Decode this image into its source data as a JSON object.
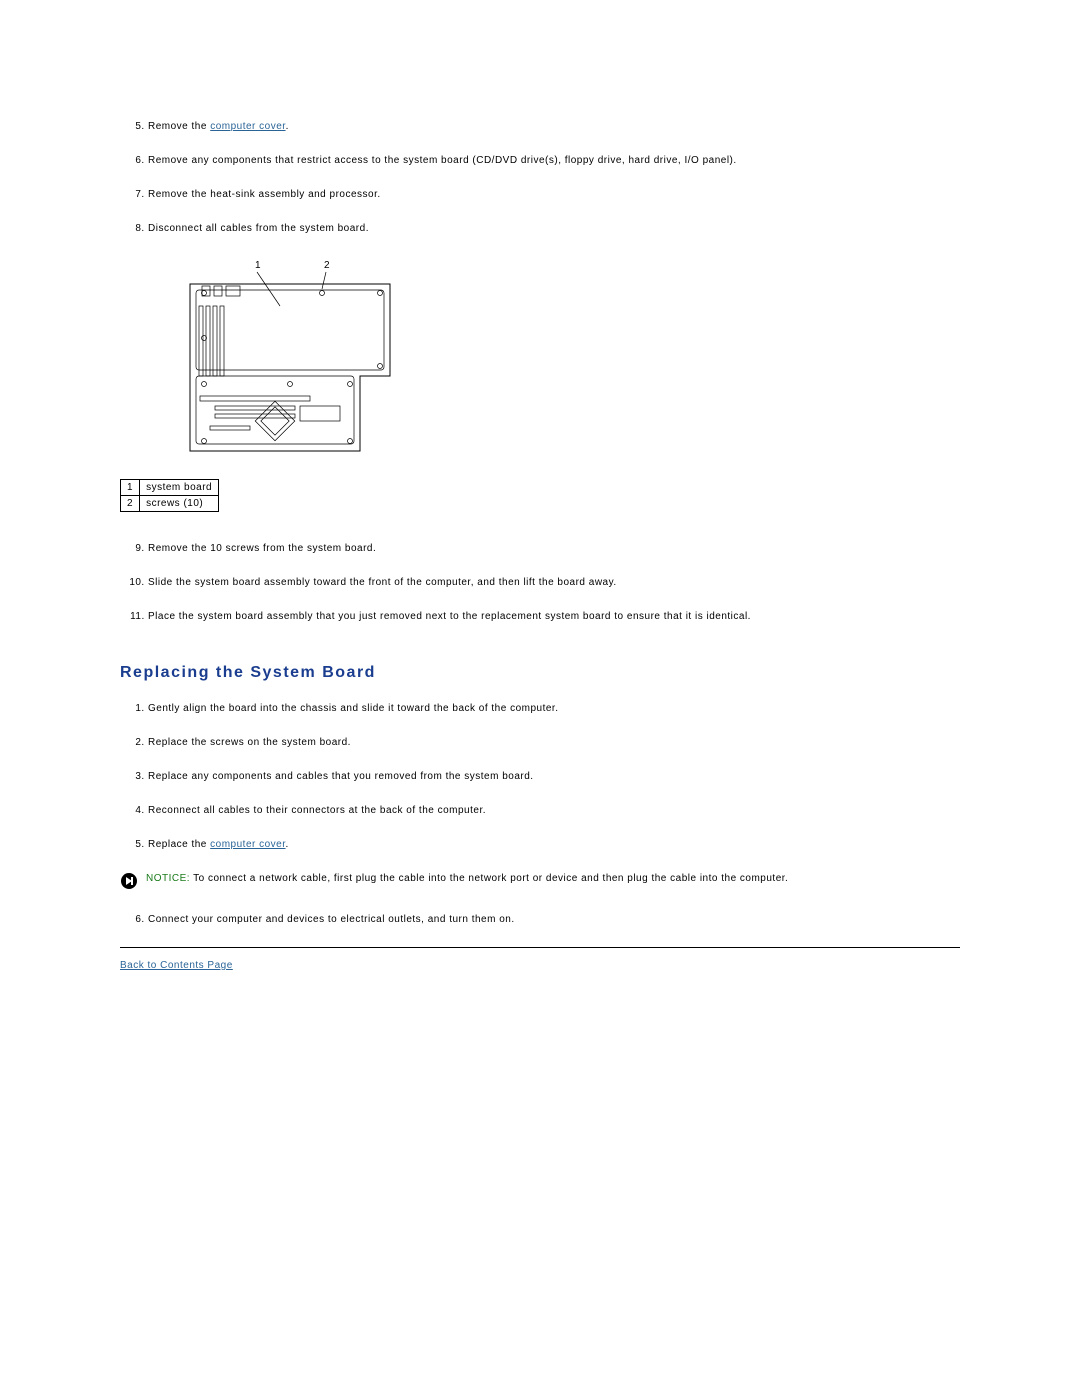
{
  "list1": {
    "start": 5,
    "items": [
      {
        "prefix": "Remove the ",
        "link": "computer cover",
        "suffix": "."
      },
      {
        "text": "Remove any components that restrict access to the system board (CD/DVD drive(s), floppy drive, hard drive, I/O panel)."
      },
      {
        "text": "Remove the heat-sink assembly and processor."
      },
      {
        "text": "Disconnect all cables from the system board."
      }
    ]
  },
  "diagram": {
    "labels": {
      "l1": "1",
      "l2": "2"
    },
    "legend": [
      {
        "num": "1",
        "label": "system board"
      },
      {
        "num": "2",
        "label": "screws (10)"
      }
    ]
  },
  "list2": {
    "start": 9,
    "items": [
      {
        "text": "Remove the 10 screws from the system board."
      },
      {
        "text": "Slide the system board assembly toward the front of the computer, and then lift the board away."
      },
      {
        "text": "Place the system board assembly that you just removed next to the replacement system board to ensure that it is identical."
      }
    ]
  },
  "section_heading": "Replacing the System Board",
  "list3": {
    "start": 1,
    "items": [
      {
        "text": "Gently align the board into the chassis and slide it toward the back of the computer."
      },
      {
        "text": "Replace the screws on the system board."
      },
      {
        "text": "Replace any components and cables that you removed from the system board."
      },
      {
        "text": "Reconnect all cables to their connectors at the back of the computer."
      },
      {
        "prefix": "Replace the ",
        "link": "computer cover",
        "suffix": "."
      }
    ]
  },
  "notice": {
    "label": "NOTICE:",
    "text": " To connect a network cable, first plug the cable into the network port or device and then plug the cable into the computer."
  },
  "list4": {
    "start": 6,
    "items": [
      {
        "text": "Connect your computer and devices to electrical outlets, and turn them on."
      }
    ]
  },
  "back_link": "Back to Contents Page"
}
